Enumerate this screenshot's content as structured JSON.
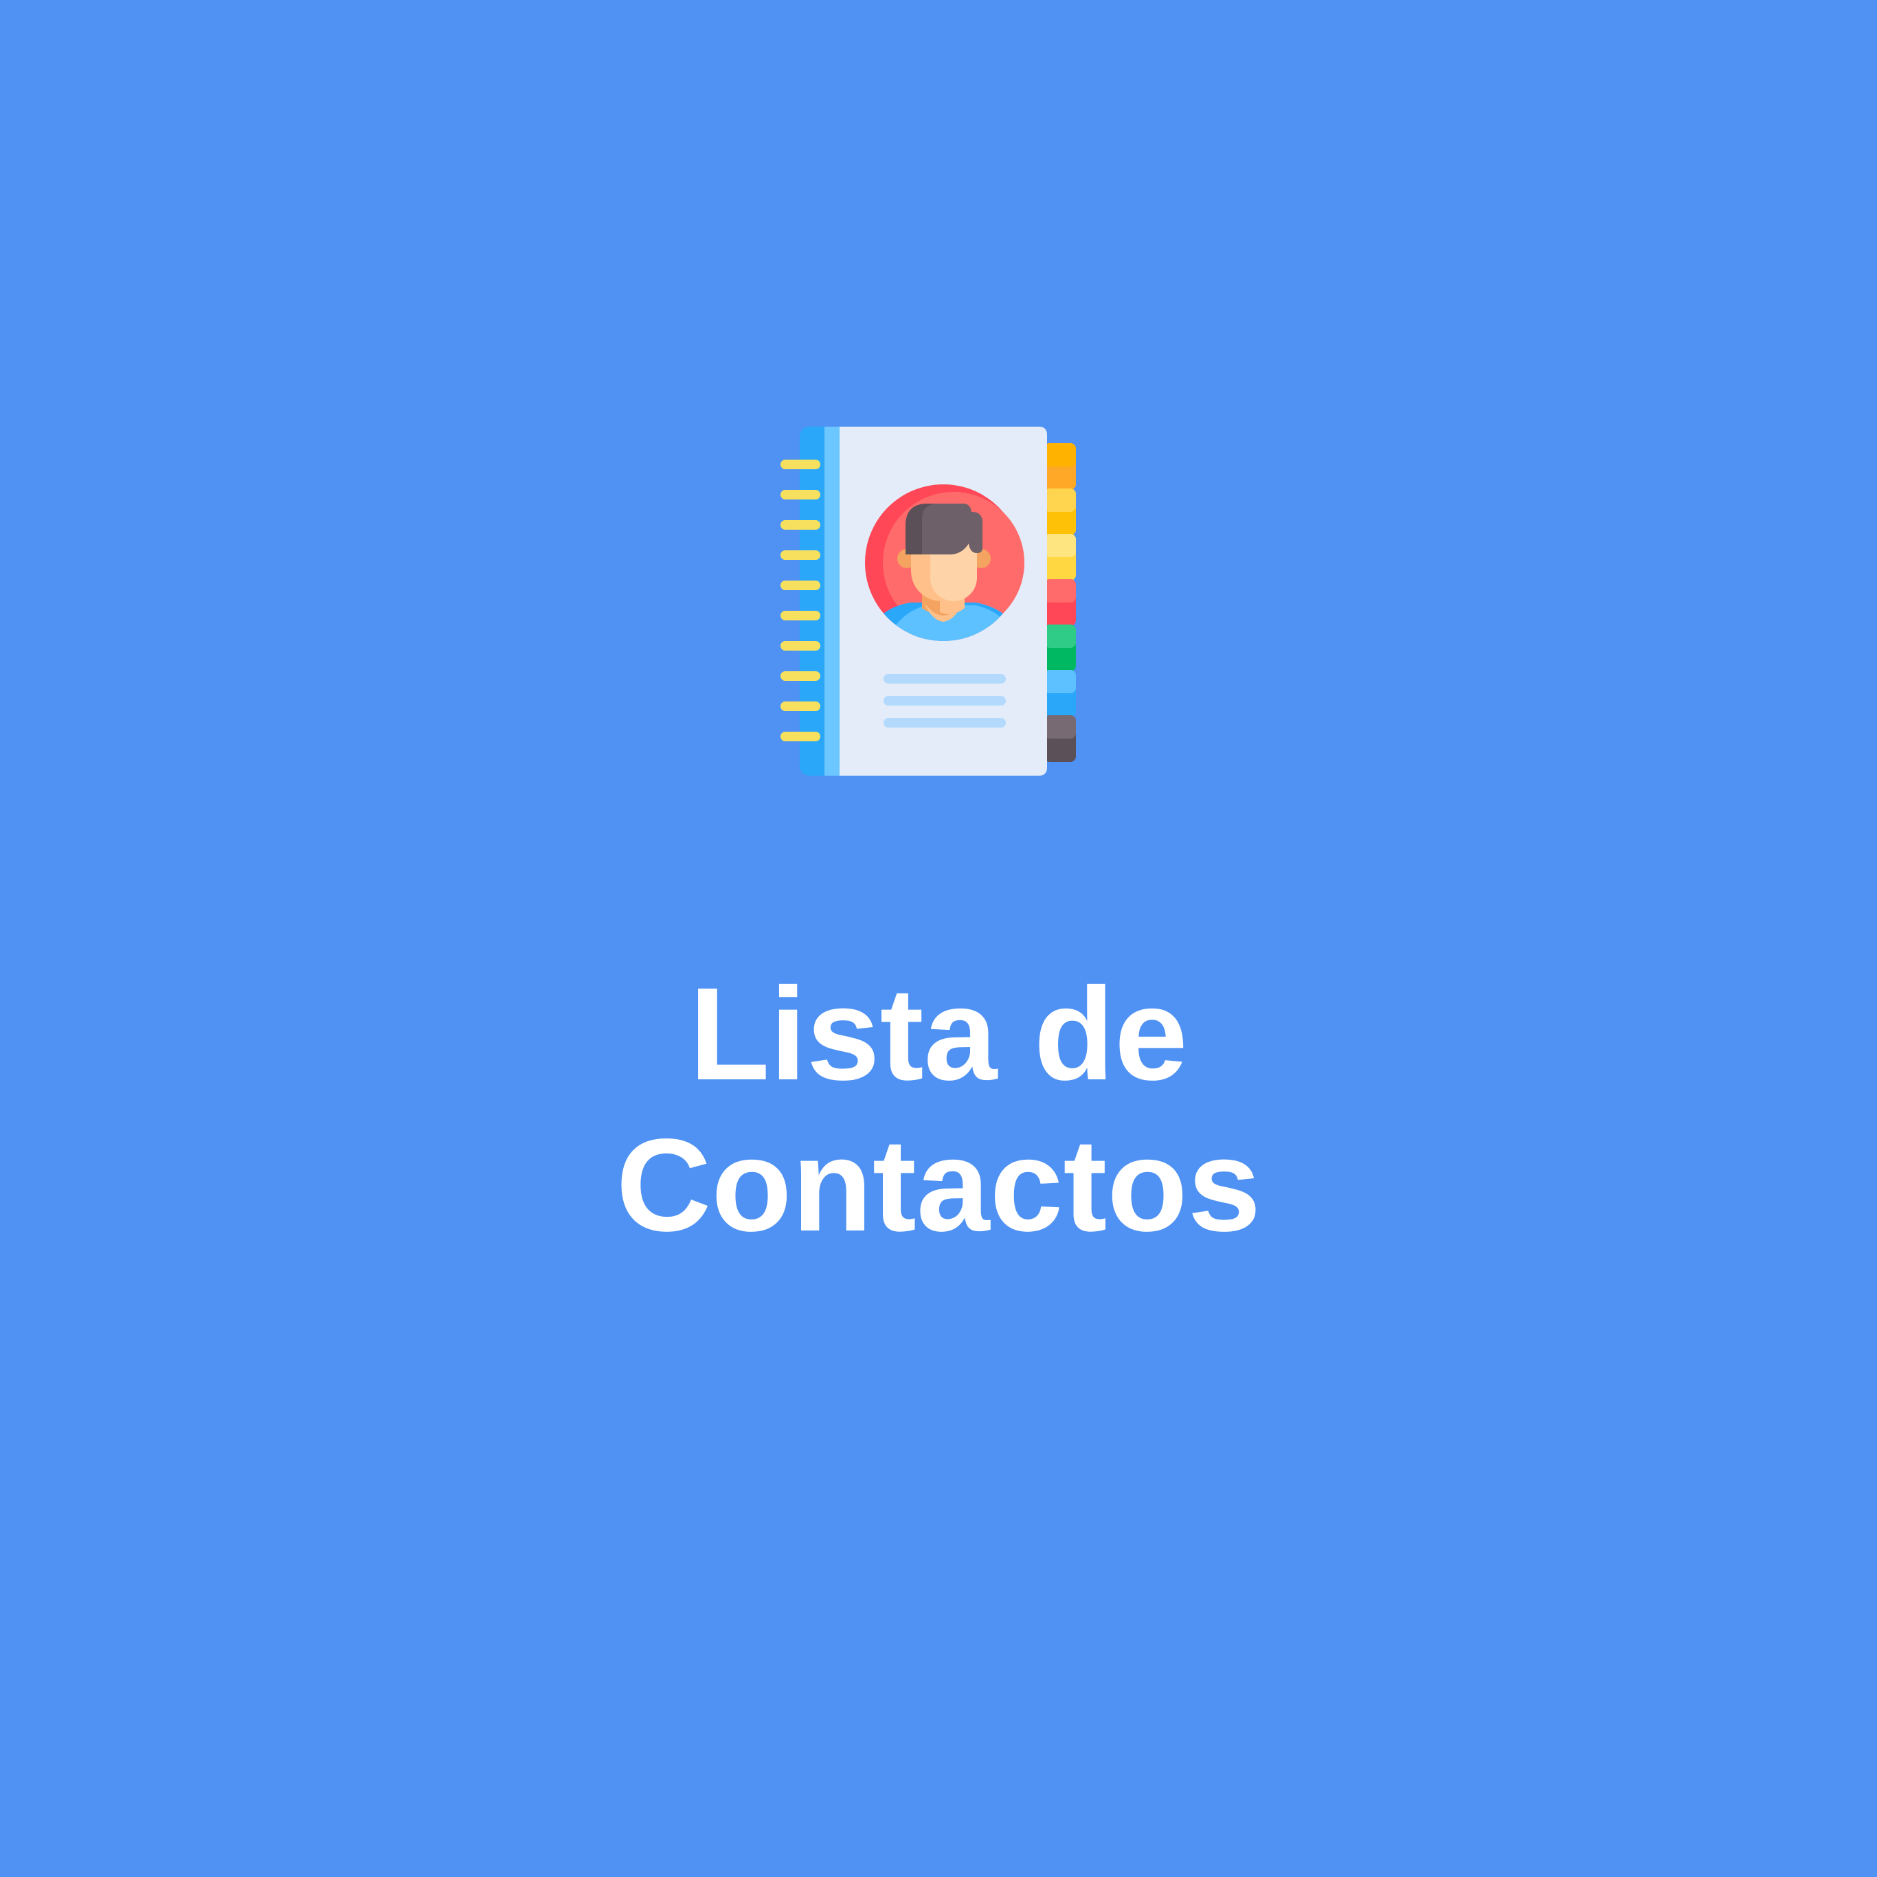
{
  "app": {
    "title_line_1": "Lista de",
    "title_line_2": "Contactos",
    "logo_icon": "contact-book-icon"
  },
  "colors": {
    "background": "#4f92f3",
    "title_text": "#ffffff",
    "book_spine": "#2aa7f9",
    "book_cover": "#e3ecf8",
    "spiral_rings": "#f6e05e",
    "avatar_circle": "#ff6b6b",
    "tabs": [
      "#ffb300",
      "#ffc107",
      "#ffd740",
      "#ff5252",
      "#1fc16b",
      "#42b4f6",
      "#6d6068"
    ]
  }
}
